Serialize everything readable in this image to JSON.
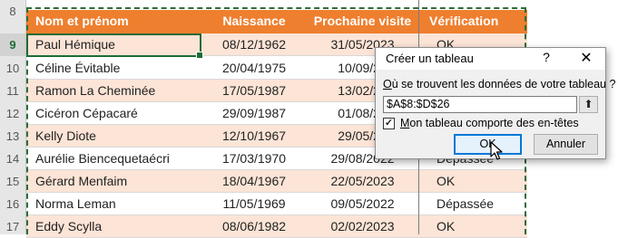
{
  "row_numbers": [
    "8",
    "9",
    "10",
    "11",
    "12",
    "13",
    "14",
    "15",
    "16",
    "17"
  ],
  "selected_row": "9",
  "headers": [
    "Nom et prénom",
    "Naissance",
    "Prochaine visite",
    "Vérification"
  ],
  "rows": [
    [
      "Paul Hémique",
      "08/12/1962",
      "31/05/2023",
      "OK"
    ],
    [
      "Céline Évitable",
      "20/04/1975",
      "10/09/20",
      ""
    ],
    [
      "Ramon La Cheminée",
      "17/05/1987",
      "13/02/20",
      ""
    ],
    [
      "Cicéron Cépacaré",
      "29/09/1987",
      "01/08/20",
      ""
    ],
    [
      "Kelly Diote",
      "12/10/1967",
      "29/05/20",
      ""
    ],
    [
      "Aurélie Biencequetaécri",
      "17/03/1970",
      "29/08/2022",
      "Dépassée"
    ],
    [
      "Gérard Menfaim",
      "18/04/1967",
      "22/05/2023",
      "OK"
    ],
    [
      "Norma Leman",
      "11/05/1969",
      "09/05/2022",
      "Dépassée"
    ],
    [
      "Eddy Scylla",
      "08/06/1982",
      "02/02/2023",
      "OK"
    ]
  ],
  "dialog": {
    "title": "Créer un tableau",
    "help": "?",
    "close": "✕",
    "question_first": "O",
    "question_rest": "ù se trouvent les données de votre tableau ?",
    "range_value": "$A$8:$D$26",
    "collapse_icon": "⬆",
    "checkbox_mark": "✓",
    "checkbox_label_first": "M",
    "checkbox_label_rest": "on tableau comporte des en-têtes",
    "ok_label": "OK",
    "cancel_label": "Annuler"
  },
  "colors": {
    "header_bg": "#ee7f2f",
    "band_bg": "#fce4d6",
    "selection_green": "#1e6b34",
    "focus_blue": "#0078d7"
  }
}
